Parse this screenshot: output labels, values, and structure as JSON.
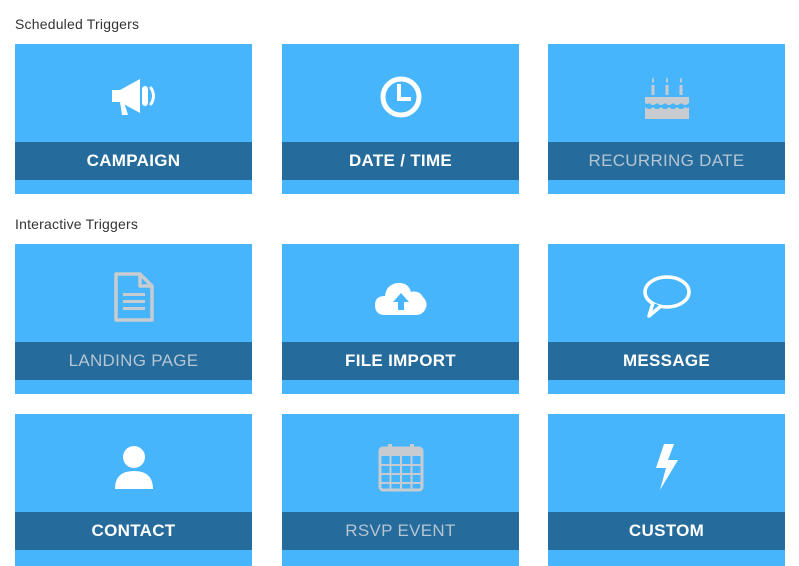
{
  "sections": {
    "scheduled": {
      "title": "Scheduled Triggers",
      "tiles": [
        {
          "label": "CAMPAIGN",
          "icon": "megaphone-icon",
          "enabled": true
        },
        {
          "label": "DATE / TIME",
          "icon": "clock-icon",
          "enabled": true
        },
        {
          "label": "RECURRING DATE",
          "icon": "birthday-cake-icon",
          "enabled": false
        }
      ]
    },
    "interactive": {
      "title": "Interactive Triggers",
      "tiles": [
        {
          "label": "LANDING PAGE",
          "icon": "document-icon",
          "enabled": false
        },
        {
          "label": "FILE IMPORT",
          "icon": "cloud-upload-icon",
          "enabled": true
        },
        {
          "label": "MESSAGE",
          "icon": "speech-bubble-icon",
          "enabled": true
        },
        {
          "label": "CONTACT",
          "icon": "user-icon",
          "enabled": true
        },
        {
          "label": "RSVP EVENT",
          "icon": "calendar-icon",
          "enabled": false
        },
        {
          "label": "CUSTOM",
          "icon": "lightning-bolt-icon",
          "enabled": true
        }
      ]
    }
  },
  "colors": {
    "tile_background": "#46b5fb",
    "label_bar": "#256b9c",
    "label_text": "#ffffff",
    "label_text_disabled": "#b5c5d2",
    "icon_enabled": "#ffffff",
    "icon_disabled": "#c8ccd0",
    "section_title": "#333333"
  }
}
